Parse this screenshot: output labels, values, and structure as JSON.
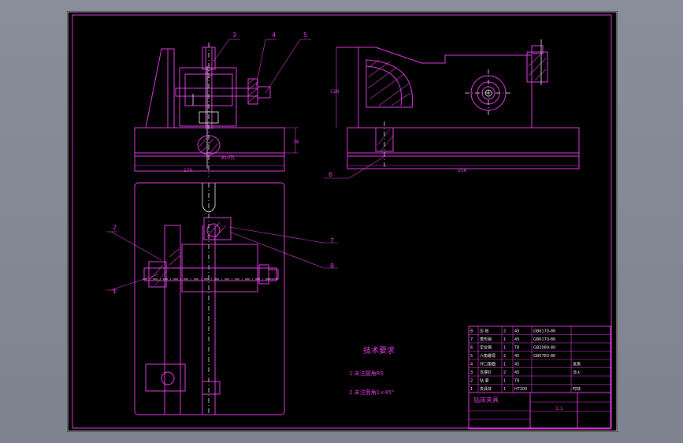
{
  "tech_requirements": {
    "heading": "技术要求",
    "items": [
      "1.未注圆角R5",
      "2.未注倒角1×45°"
    ]
  },
  "callouts": [
    "1",
    "2",
    "3",
    "4",
    "5",
    "6",
    "7",
    "8"
  ],
  "dimensions": {
    "front_width": "170",
    "front_height": "38",
    "front_hole": "ø10孔",
    "side_width": "256",
    "side_height": "128"
  },
  "title_block": {
    "title": "钻床夹具",
    "scale": "1:1",
    "rows": [
      {
        "no": "8",
        "name": "压 板",
        "qty": "2",
        "material": "45",
        "std": "GB6170-86",
        "note": ""
      },
      {
        "no": "7",
        "name": "菱形销",
        "qty": "1",
        "material": "45",
        "std": "GB6170-86",
        "note": ""
      },
      {
        "no": "6",
        "name": "定位销",
        "qty": "1",
        "material": "T8",
        "std": "GB2089-80",
        "note": ""
      },
      {
        "no": "5",
        "name": "六角螺母",
        "qty": "2",
        "material": "45",
        "std": "GB5783-86",
        "note": ""
      },
      {
        "no": "4",
        "name": "开口垫圈",
        "qty": "1",
        "material": "45",
        "std": "",
        "note": "发黑"
      },
      {
        "no": "3",
        "name": "支撑钉",
        "qty": "2",
        "material": "45",
        "std": "",
        "note": "淬火"
      },
      {
        "no": "2",
        "name": "钻 套",
        "qty": "1",
        "material": "T8",
        "std": "",
        "note": ""
      },
      {
        "no": "1",
        "name": "夹具体",
        "qty": "1",
        "material": "HT200",
        "std": "",
        "note": "时效"
      }
    ]
  }
}
